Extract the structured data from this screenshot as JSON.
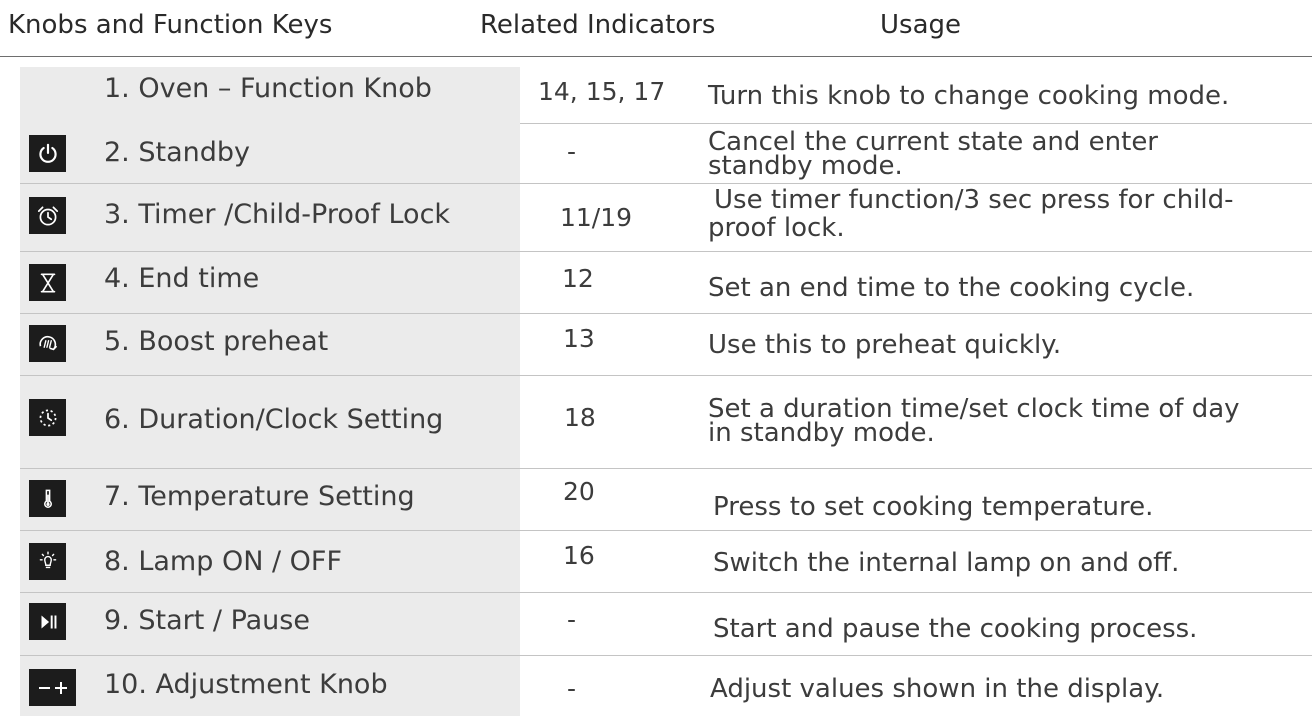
{
  "headers": {
    "col1": "Knobs and Function Keys",
    "col2": "Related Indicators",
    "col3": "Usage"
  },
  "rows": [
    {
      "name": "1. Oven – Function Knob",
      "indicators": "14, 15, 17",
      "usage": [
        "Turn this knob to change cooking mode."
      ],
      "icon": ""
    },
    {
      "name": "2. Standby",
      "indicators": "-",
      "usage": [
        "Cancel the current state and enter",
        "standby mode."
      ],
      "icon": "power-icon"
    },
    {
      "name": "3. Timer /Child-Proof Lock",
      "indicators": "11/19",
      "usage": [
        "Use timer function/3 sec press for child-",
        "proof lock."
      ],
      "icon": "alarm-clock-icon"
    },
    {
      "name": "4. End time",
      "indicators": "12",
      "usage": [
        "Set an end time to the cooking cycle."
      ],
      "icon": "hourglass-icon"
    },
    {
      "name": "5. Boost preheat",
      "indicators": "13",
      "usage": [
        "Use this to preheat quickly."
      ],
      "icon": "boost-preheat-icon"
    },
    {
      "name": "6. Duration/Clock Setting",
      "indicators": "18",
      "usage": [
        "Set a duration time/set clock time of day",
        "in standby mode."
      ],
      "icon": "duration-clock-icon"
    },
    {
      "name": "7. Temperature Setting",
      "indicators": "20",
      "usage": [
        "Press to set cooking temperature."
      ],
      "icon": "thermometer-icon"
    },
    {
      "name": "8. Lamp ON / OFF",
      "indicators": "16",
      "usage": [
        "Switch the internal lamp on and off."
      ],
      "icon": "lamp-icon"
    },
    {
      "name": "9. Start / Pause",
      "indicators": "-",
      "usage": [
        "Start and pause the cooking process."
      ],
      "icon": "play-pause-icon"
    },
    {
      "name": "10. Adjustment Knob",
      "indicators": "-",
      "usage": [
        "Adjust values shown in the display."
      ],
      "icon": "minus-plus-icon"
    }
  ]
}
